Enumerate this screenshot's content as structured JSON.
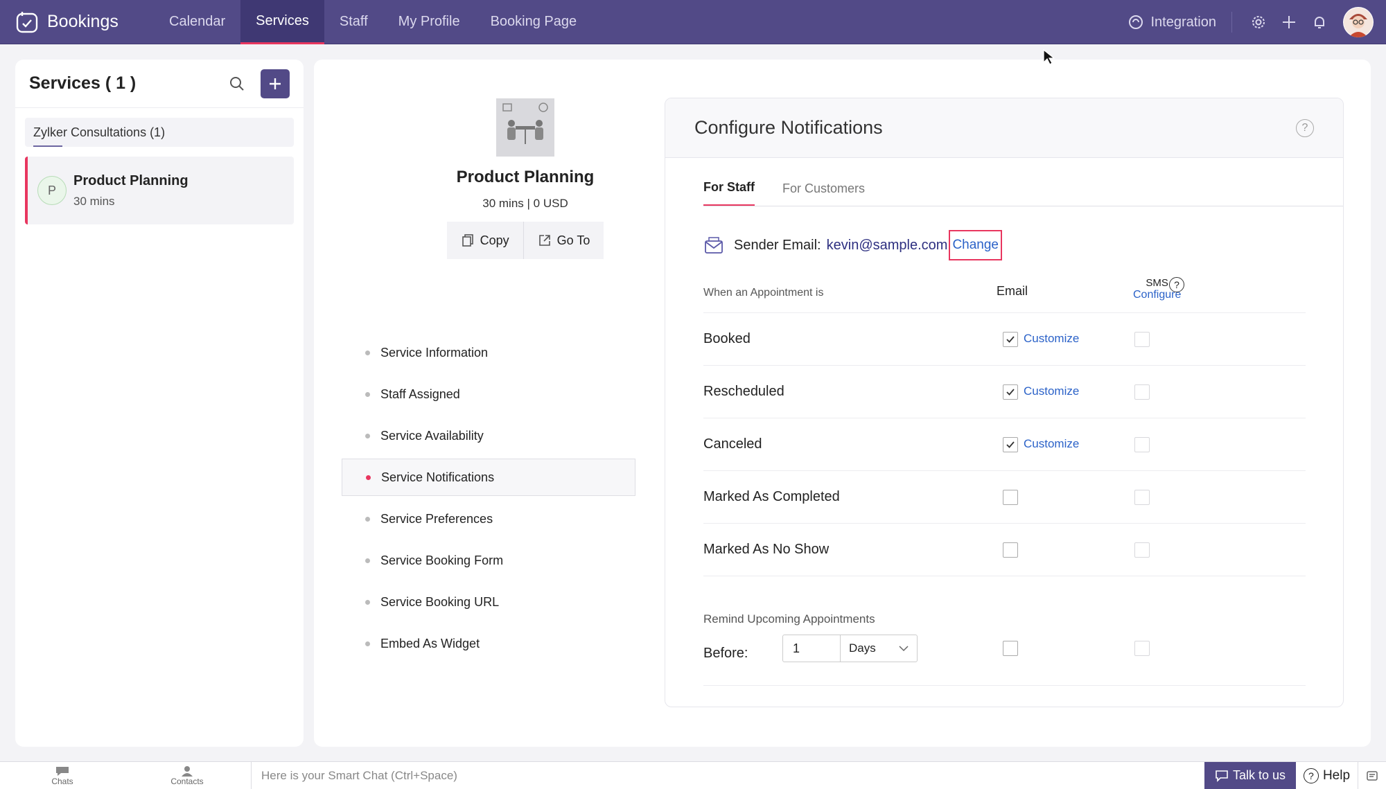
{
  "app": {
    "name": "Bookings"
  },
  "nav": {
    "tabs": [
      "Calendar",
      "Services",
      "Staff",
      "My Profile",
      "Booking Page"
    ],
    "active": "Services"
  },
  "topbar": {
    "integration_label": "Integration"
  },
  "left": {
    "title": "Services ( 1 )",
    "group": "Zylker Consultations (1)",
    "service": {
      "initial": "P",
      "name": "Product Planning",
      "duration": "30 mins"
    }
  },
  "service_head": {
    "title": "Product Planning",
    "meta": "30 mins | 0 USD",
    "copy_label": "Copy",
    "goto_label": "Go To"
  },
  "menu": {
    "items": [
      "Service Information",
      "Staff Assigned",
      "Service Availability",
      "Service Notifications",
      "Service Preferences",
      "Service Booking Form",
      "Service Booking URL",
      "Embed As Widget"
    ],
    "active": "Service Notifications"
  },
  "config": {
    "title": "Configure Notifications",
    "help": "?",
    "tabs": [
      "For Staff",
      "For Customers"
    ],
    "active_tab": "For Staff",
    "sender_label": "Sender Email:",
    "sender_email": "kevin@sample.com",
    "change_label": "Change",
    "when_label": "When an Appointment is",
    "email_col": "Email",
    "sms_col": "SMS",
    "sms_configure": "Configure",
    "customize_label": "Customize",
    "rows": [
      {
        "name": "Booked",
        "email": true,
        "sms": false
      },
      {
        "name": "Rescheduled",
        "email": true,
        "sms": false
      },
      {
        "name": "Canceled",
        "email": true,
        "sms": false
      },
      {
        "name": "Marked As Completed",
        "email": false,
        "sms": false
      },
      {
        "name": "Marked As No Show",
        "email": false,
        "sms": false
      }
    ],
    "remind_title": "Remind Upcoming Appointments",
    "before_label": "Before:",
    "before_value": "1",
    "before_unit": "Days"
  },
  "bottombar": {
    "chats_label": "Chats",
    "contacts_label": "Contacts",
    "smart_chat_placeholder": "Here is your Smart Chat (Ctrl+Space)",
    "talk_label": "Talk to us",
    "help_label": "Help"
  },
  "colors": {
    "brand": "#524a87",
    "accent": "#e8365f",
    "link": "#2b62c8"
  }
}
